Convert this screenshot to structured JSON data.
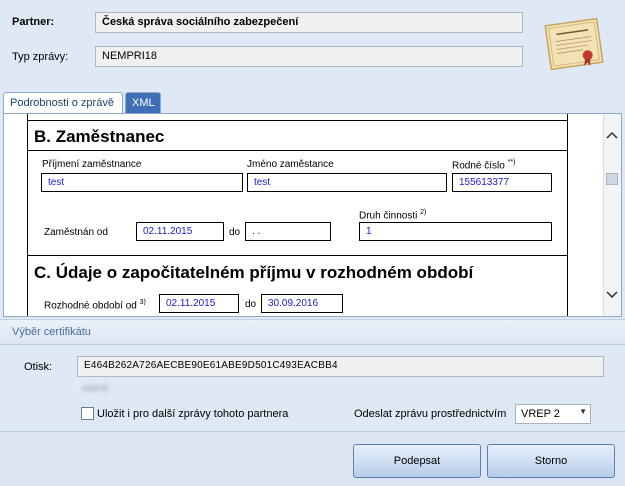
{
  "header": {
    "partner_label": "Partner:",
    "partner_value": "Česká správa sociálního zabezpečení",
    "type_label": "Typ zprávy:",
    "type_value": "NEMPRI18"
  },
  "tabs": [
    {
      "label": "Podrobnosti o zprávě",
      "active": true
    },
    {
      "label": "XML",
      "active": false
    }
  ],
  "document": {
    "section_b_title": "B. Zaměstnanec",
    "surname_label": "Příjmení zaměstnance",
    "surname_value": "test",
    "firstname_label": "Jméno zaměstance",
    "firstname_value": "test",
    "birthno_label": "Rodné číslo",
    "birthno_sup": "**)",
    "birthno_value": "155613377",
    "employed_from_label": "Zaměstnán od",
    "employed_from_value": "02.11.2015",
    "to_label": "do",
    "to_value": ". .",
    "activity_label": "Druh činnosti",
    "activity_sup": "2)",
    "activity_value": "1",
    "section_c_title": "C. Údaje o započitatelném příjmu v rozhodném období",
    "period_label": "Rozhodné období od",
    "period_sup": "3)",
    "period_from_value": "02.11.2015",
    "period_to_label": "do",
    "period_to_value": "30.09.2016"
  },
  "certificate": {
    "section_label": "Výběr certifikátu",
    "otisk_label": "Otisk:",
    "otisk_value": "E464B262A726AECBE90E61ABE9D501C493EACBB4",
    "blurred_text": "ucet-ic",
    "save_checkbox_label": "Uložit i pro další zprávy tohoto partnera",
    "save_checked": false,
    "send_label": "Odeslat zprávu prostřednictvím",
    "send_value": "VREP 2"
  },
  "buttons": {
    "sign": "Podepsat",
    "cancel": "Storno"
  },
  "icons": {
    "certificate": "certificate-document-icon",
    "scroll_up": "chevron-up-icon",
    "scroll_down": "chevron-down-icon",
    "dropdown": "dropdown-arrow-icon"
  }
}
